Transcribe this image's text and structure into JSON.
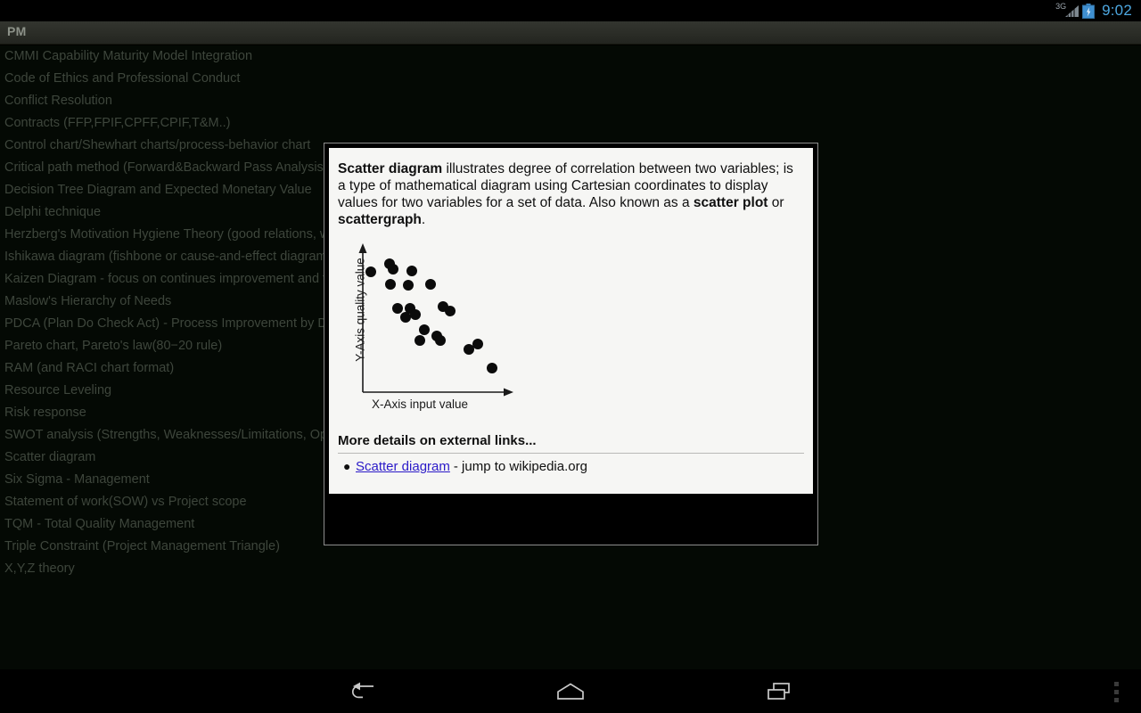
{
  "statusbar": {
    "network_label": "3G",
    "time": "9:02",
    "time_color": "#4da7e0",
    "signal_icon": "signal-bars-icon",
    "battery_icon": "battery-charging-icon"
  },
  "actionbar": {
    "title": "PM"
  },
  "list": {
    "items": [
      "CMMI Capability Maturity Model Integration",
      "Code of Ethics and Professional Conduct",
      "Conflict Resolution",
      "Contracts (FFP,FPIF,CPFF,CPIF,T&M..)",
      "Control chart/Shewhart charts/process-behavior chart",
      "Critical path method (Forward&Backward Pass Analysis)",
      "Decision Tree Diagram and Expected Monetary Value",
      "Delphi technique",
      "Herzberg's Motivation Hygiene Theory (good relations, wo",
      "Ishikawa diagram (fishbone or cause-and-effect diagram",
      "Kaizen Diagram - focus on continues improvement and to",
      "Maslow's Hierarchy of Needs",
      "PDCA (Plan Do Check Act) - Process Improvement by Dem",
      "Pareto chart, Pareto's law(80−20 rule)",
      "RAM (and RACI chart format)",
      "Resource Leveling",
      "Risk response",
      "SWOT analysis (Strengths, Weaknesses/Limitations, Opp",
      "Scatter diagram",
      "Six Sigma - Management",
      "Statement of work(SOW) vs Project scope",
      "TQM - Total Quality Management",
      "Triple Constraint (Project Management Triangle)",
      "X,Y,Z theory"
    ]
  },
  "dialog": {
    "description": {
      "term": "Scatter diagram",
      "text_1": " illustrates degree of correlation between two variables; is a type of mathematical diagram using Cartesian coordinates to display values for two variables for a set of data. Also known as a ",
      "alt_term_1": "scatter plot",
      "text_2": " or ",
      "alt_term_2": "scattergraph",
      "text_3": "."
    },
    "links_heading": "More details on external links...",
    "link": {
      "label": "Scatter diagram",
      "tail": "- jump to wikipedia.org",
      "color": "#2a19c8"
    }
  },
  "chart_data": {
    "type": "scatter",
    "title": "",
    "xlabel": "X-Axis input value",
    "ylabel": "Y-Axis quality value",
    "xlim": [
      0,
      100
    ],
    "ylim": [
      0,
      100
    ],
    "grid": false,
    "legend": false,
    "marker_color": "#0b0b0b",
    "points": [
      {
        "x": 6,
        "y": 82
      },
      {
        "x": 19,
        "y": 88
      },
      {
        "x": 22,
        "y": 84
      },
      {
        "x": 35,
        "y": 83
      },
      {
        "x": 20,
        "y": 73
      },
      {
        "x": 33,
        "y": 72
      },
      {
        "x": 49,
        "y": 73
      },
      {
        "x": 25,
        "y": 55
      },
      {
        "x": 34,
        "y": 55
      },
      {
        "x": 31,
        "y": 48
      },
      {
        "x": 38,
        "y": 50
      },
      {
        "x": 58,
        "y": 56
      },
      {
        "x": 63,
        "y": 53
      },
      {
        "x": 44,
        "y": 39
      },
      {
        "x": 41,
        "y": 31
      },
      {
        "x": 53,
        "y": 34
      },
      {
        "x": 56,
        "y": 31
      },
      {
        "x": 76,
        "y": 24
      },
      {
        "x": 83,
        "y": 28
      },
      {
        "x": 93,
        "y": 10
      }
    ]
  },
  "navbar": {
    "back_icon": "back-arrow-icon",
    "home_icon": "home-icon",
    "recents_icon": "recent-apps-icon",
    "overflow_icon": "overflow-menu-icon"
  }
}
